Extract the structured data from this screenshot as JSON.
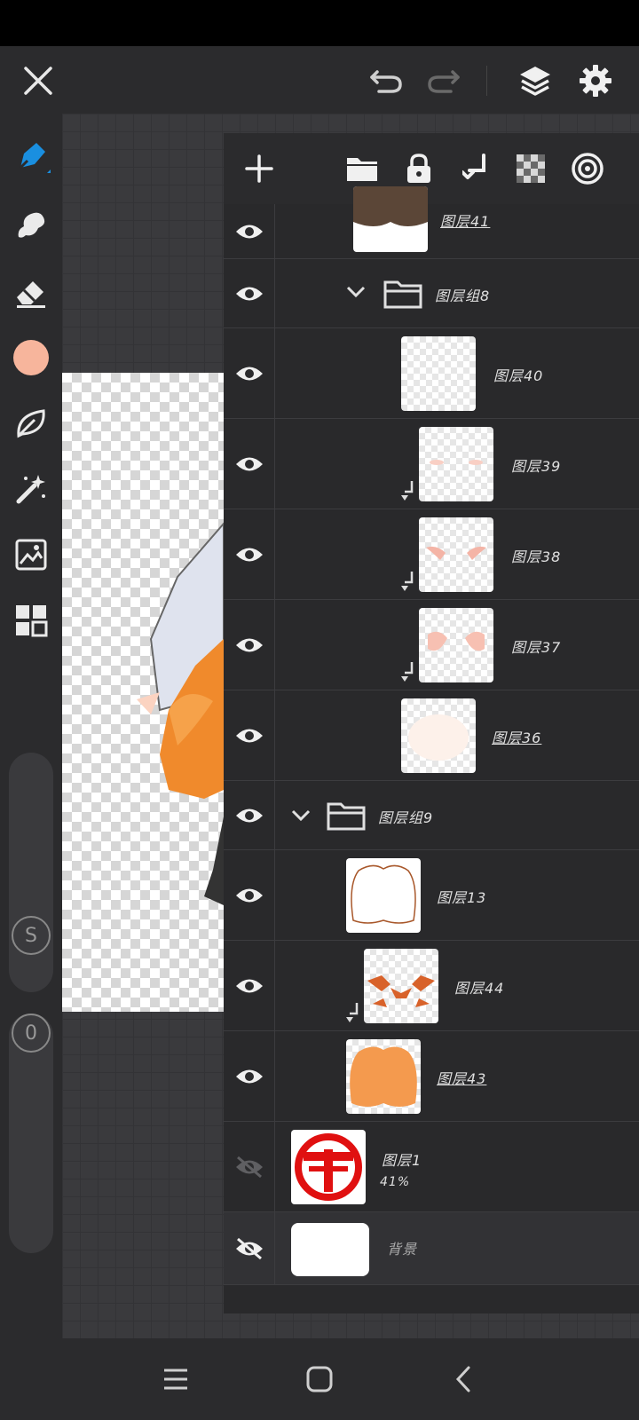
{
  "colors": {
    "accent": "#1a8fe0",
    "brush_color": "#f7b59c",
    "panel_bg": "#2b2b2d"
  },
  "topbar": {
    "close_icon": "close-icon",
    "undo_icon": "undo-icon",
    "redo_icon": "redo-icon",
    "layers_icon": "layers-icon",
    "settings_icon": "gear-icon"
  },
  "tools": [
    "pen-tool",
    "smudge-tool",
    "eraser-tool",
    "color-swatch",
    "leaf-tool",
    "magic-wand-tool",
    "image-import-tool",
    "gallery-grid-tool"
  ],
  "rail": {
    "size_label": "S",
    "opacity_label": "0"
  },
  "layers_toolbar": [
    "add-layer",
    "new-folder",
    "lock",
    "merge-down",
    "transparency",
    "reference"
  ],
  "layers": [
    {
      "name": "图层41",
      "type": "layer",
      "visible": true
    },
    {
      "name": "图层组8",
      "type": "group",
      "visible": true
    },
    {
      "name": "图层40",
      "type": "layer",
      "visible": true
    },
    {
      "name": "图层39",
      "type": "layer",
      "visible": true
    },
    {
      "name": "图层38",
      "type": "layer",
      "visible": true
    },
    {
      "name": "图层37",
      "type": "layer",
      "visible": true
    },
    {
      "name": "图层36",
      "type": "layer",
      "visible": true
    },
    {
      "name": "图层组9",
      "type": "group",
      "visible": true
    },
    {
      "name": "图层13",
      "type": "layer",
      "visible": true
    },
    {
      "name": "图层44",
      "type": "layer",
      "visible": true
    },
    {
      "name": "图层43",
      "type": "layer",
      "visible": true
    },
    {
      "name": "图层1",
      "type": "layer",
      "visible": false,
      "opacity": "41%"
    },
    {
      "name": "背景",
      "type": "background",
      "visible": false
    }
  ],
  "navbar": [
    "recent-apps",
    "home",
    "back"
  ]
}
